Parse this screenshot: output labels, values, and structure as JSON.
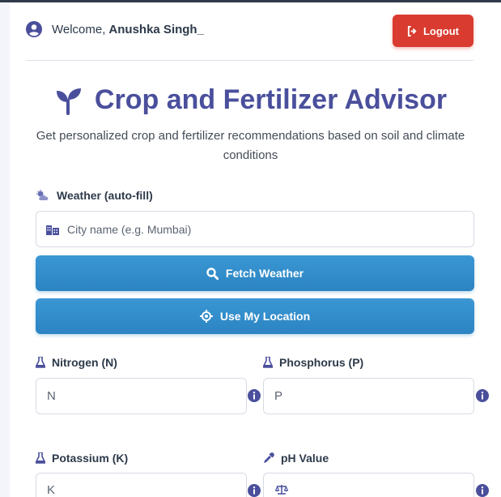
{
  "header": {
    "welcome_prefix": "Welcome,",
    "user_name": "Anushka Singh_",
    "logout_label": "Logout"
  },
  "hero": {
    "title": "Crop and Fertilizer Advisor",
    "subtitle": "Get personalized crop and fertilizer recommendations based on soil and climate conditions"
  },
  "weather": {
    "label": "Weather (auto-fill)",
    "city_placeholder": "City name (e.g. Mumbai)",
    "fetch_label": "Fetch Weather",
    "location_label": "Use My Location"
  },
  "fields": {
    "nitrogen": {
      "label": "Nitrogen (N)",
      "placeholder": "N"
    },
    "phosphorus": {
      "label": "Phosphorus (P)",
      "placeholder": "P"
    },
    "potassium": {
      "label": "Potassium (K)",
      "placeholder": "K"
    },
    "ph": {
      "label": "pH Value"
    }
  },
  "colors": {
    "brand": "#4a4f9c",
    "primary_button": "#2c84c2",
    "logout": "#d93b30"
  }
}
